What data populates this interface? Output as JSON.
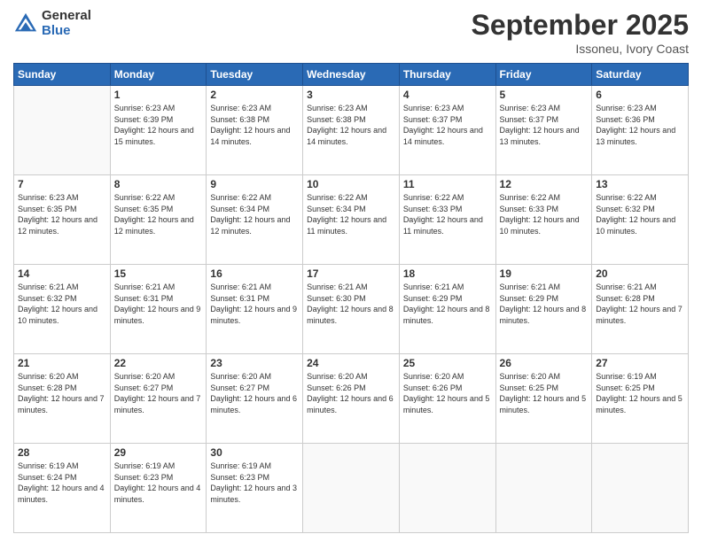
{
  "logo": {
    "general": "General",
    "blue": "Blue"
  },
  "header": {
    "month": "September 2025",
    "location": "Issoneu, Ivory Coast"
  },
  "weekdays": [
    "Sunday",
    "Monday",
    "Tuesday",
    "Wednesday",
    "Thursday",
    "Friday",
    "Saturday"
  ],
  "weeks": [
    [
      {
        "day": "",
        "sunrise": "",
        "sunset": "",
        "daylight": "",
        "empty": true
      },
      {
        "day": "1",
        "sunrise": "Sunrise: 6:23 AM",
        "sunset": "Sunset: 6:39 PM",
        "daylight": "Daylight: 12 hours and 15 minutes."
      },
      {
        "day": "2",
        "sunrise": "Sunrise: 6:23 AM",
        "sunset": "Sunset: 6:38 PM",
        "daylight": "Daylight: 12 hours and 14 minutes."
      },
      {
        "day": "3",
        "sunrise": "Sunrise: 6:23 AM",
        "sunset": "Sunset: 6:38 PM",
        "daylight": "Daylight: 12 hours and 14 minutes."
      },
      {
        "day": "4",
        "sunrise": "Sunrise: 6:23 AM",
        "sunset": "Sunset: 6:37 PM",
        "daylight": "Daylight: 12 hours and 14 minutes."
      },
      {
        "day": "5",
        "sunrise": "Sunrise: 6:23 AM",
        "sunset": "Sunset: 6:37 PM",
        "daylight": "Daylight: 12 hours and 13 minutes."
      },
      {
        "day": "6",
        "sunrise": "Sunrise: 6:23 AM",
        "sunset": "Sunset: 6:36 PM",
        "daylight": "Daylight: 12 hours and 13 minutes."
      }
    ],
    [
      {
        "day": "7",
        "sunrise": "Sunrise: 6:23 AM",
        "sunset": "Sunset: 6:35 PM",
        "daylight": "Daylight: 12 hours and 12 minutes."
      },
      {
        "day": "8",
        "sunrise": "Sunrise: 6:22 AM",
        "sunset": "Sunset: 6:35 PM",
        "daylight": "Daylight: 12 hours and 12 minutes."
      },
      {
        "day": "9",
        "sunrise": "Sunrise: 6:22 AM",
        "sunset": "Sunset: 6:34 PM",
        "daylight": "Daylight: 12 hours and 12 minutes."
      },
      {
        "day": "10",
        "sunrise": "Sunrise: 6:22 AM",
        "sunset": "Sunset: 6:34 PM",
        "daylight": "Daylight: 12 hours and 11 minutes."
      },
      {
        "day": "11",
        "sunrise": "Sunrise: 6:22 AM",
        "sunset": "Sunset: 6:33 PM",
        "daylight": "Daylight: 12 hours and 11 minutes."
      },
      {
        "day": "12",
        "sunrise": "Sunrise: 6:22 AM",
        "sunset": "Sunset: 6:33 PM",
        "daylight": "Daylight: 12 hours and 10 minutes."
      },
      {
        "day": "13",
        "sunrise": "Sunrise: 6:22 AM",
        "sunset": "Sunset: 6:32 PM",
        "daylight": "Daylight: 12 hours and 10 minutes."
      }
    ],
    [
      {
        "day": "14",
        "sunrise": "Sunrise: 6:21 AM",
        "sunset": "Sunset: 6:32 PM",
        "daylight": "Daylight: 12 hours and 10 minutes."
      },
      {
        "day": "15",
        "sunrise": "Sunrise: 6:21 AM",
        "sunset": "Sunset: 6:31 PM",
        "daylight": "Daylight: 12 hours and 9 minutes."
      },
      {
        "day": "16",
        "sunrise": "Sunrise: 6:21 AM",
        "sunset": "Sunset: 6:31 PM",
        "daylight": "Daylight: 12 hours and 9 minutes."
      },
      {
        "day": "17",
        "sunrise": "Sunrise: 6:21 AM",
        "sunset": "Sunset: 6:30 PM",
        "daylight": "Daylight: 12 hours and 8 minutes."
      },
      {
        "day": "18",
        "sunrise": "Sunrise: 6:21 AM",
        "sunset": "Sunset: 6:29 PM",
        "daylight": "Daylight: 12 hours and 8 minutes."
      },
      {
        "day": "19",
        "sunrise": "Sunrise: 6:21 AM",
        "sunset": "Sunset: 6:29 PM",
        "daylight": "Daylight: 12 hours and 8 minutes."
      },
      {
        "day": "20",
        "sunrise": "Sunrise: 6:21 AM",
        "sunset": "Sunset: 6:28 PM",
        "daylight": "Daylight: 12 hours and 7 minutes."
      }
    ],
    [
      {
        "day": "21",
        "sunrise": "Sunrise: 6:20 AM",
        "sunset": "Sunset: 6:28 PM",
        "daylight": "Daylight: 12 hours and 7 minutes."
      },
      {
        "day": "22",
        "sunrise": "Sunrise: 6:20 AM",
        "sunset": "Sunset: 6:27 PM",
        "daylight": "Daylight: 12 hours and 7 minutes."
      },
      {
        "day": "23",
        "sunrise": "Sunrise: 6:20 AM",
        "sunset": "Sunset: 6:27 PM",
        "daylight": "Daylight: 12 hours and 6 minutes."
      },
      {
        "day": "24",
        "sunrise": "Sunrise: 6:20 AM",
        "sunset": "Sunset: 6:26 PM",
        "daylight": "Daylight: 12 hours and 6 minutes."
      },
      {
        "day": "25",
        "sunrise": "Sunrise: 6:20 AM",
        "sunset": "Sunset: 6:26 PM",
        "daylight": "Daylight: 12 hours and 5 minutes."
      },
      {
        "day": "26",
        "sunrise": "Sunrise: 6:20 AM",
        "sunset": "Sunset: 6:25 PM",
        "daylight": "Daylight: 12 hours and 5 minutes."
      },
      {
        "day": "27",
        "sunrise": "Sunrise: 6:19 AM",
        "sunset": "Sunset: 6:25 PM",
        "daylight": "Daylight: 12 hours and 5 minutes."
      }
    ],
    [
      {
        "day": "28",
        "sunrise": "Sunrise: 6:19 AM",
        "sunset": "Sunset: 6:24 PM",
        "daylight": "Daylight: 12 hours and 4 minutes."
      },
      {
        "day": "29",
        "sunrise": "Sunrise: 6:19 AM",
        "sunset": "Sunset: 6:23 PM",
        "daylight": "Daylight: 12 hours and 4 minutes."
      },
      {
        "day": "30",
        "sunrise": "Sunrise: 6:19 AM",
        "sunset": "Sunset: 6:23 PM",
        "daylight": "Daylight: 12 hours and 3 minutes."
      },
      {
        "day": "",
        "sunrise": "",
        "sunset": "",
        "daylight": "",
        "empty": true
      },
      {
        "day": "",
        "sunrise": "",
        "sunset": "",
        "daylight": "",
        "empty": true
      },
      {
        "day": "",
        "sunrise": "",
        "sunset": "",
        "daylight": "",
        "empty": true
      },
      {
        "day": "",
        "sunrise": "",
        "sunset": "",
        "daylight": "",
        "empty": true
      }
    ]
  ]
}
